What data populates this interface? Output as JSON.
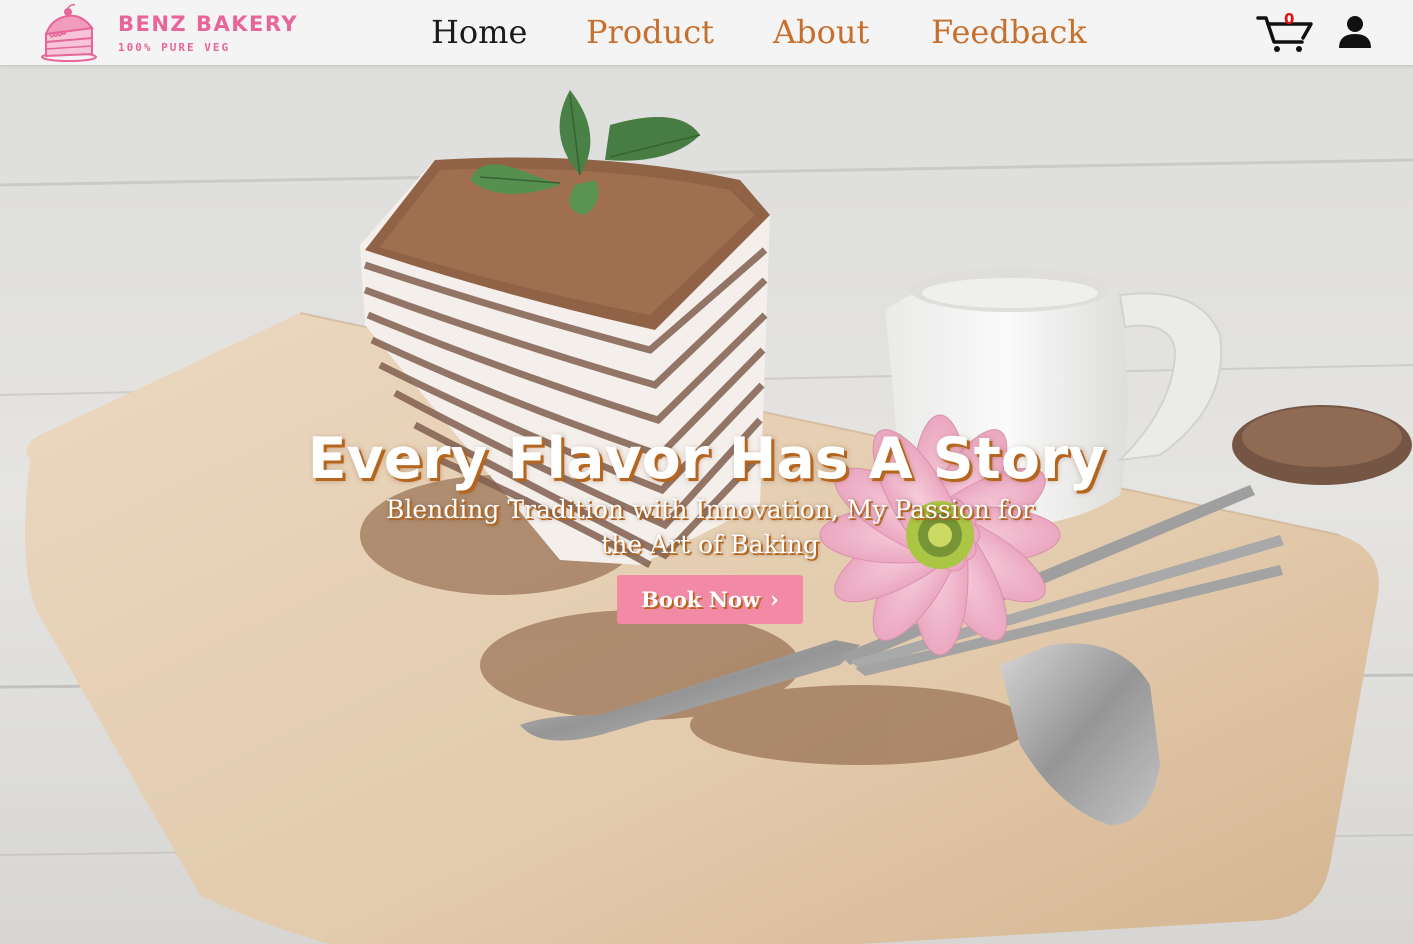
{
  "brand": {
    "name": "BENZ BAKERY",
    "tagline": "100% PURE VEG",
    "icon": "cake-slice-logo-icon",
    "color": "#e8659a"
  },
  "nav": {
    "items": [
      {
        "label": "Home",
        "active": true
      },
      {
        "label": "Product",
        "active": false
      },
      {
        "label": "About",
        "active": false
      },
      {
        "label": "Feedback",
        "active": false
      }
    ],
    "active_color": "#1a1a1a",
    "link_color": "#c7702e"
  },
  "cart": {
    "icon": "cart-icon",
    "count": "0",
    "count_color": "#e01010"
  },
  "user": {
    "icon": "user-icon"
  },
  "hero": {
    "title": "Every Flavor Has A Story",
    "subtitle": "Blending Tradition with Innovation, My Passion for the Art of Baking",
    "cta_label": "Book Now",
    "cta_icon": "chevron-right-icon",
    "cta_color": "#f28aa6",
    "text_shadow_color": "#b5651d"
  }
}
